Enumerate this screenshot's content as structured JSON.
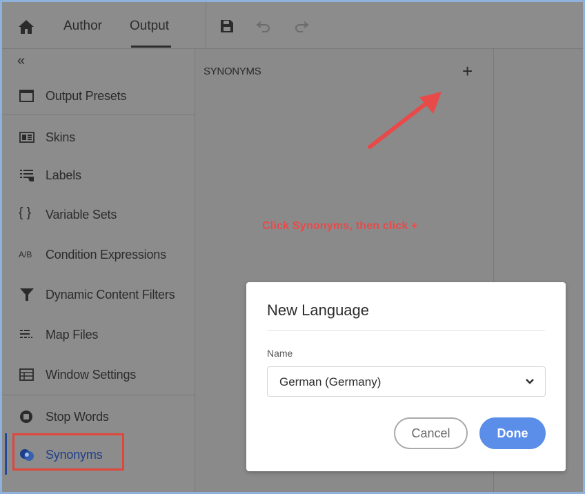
{
  "header": {
    "tabs": [
      {
        "label": "Author"
      },
      {
        "label": "Output",
        "active": true
      }
    ],
    "icons": [
      "home-icon",
      "save-icon",
      "undo-icon",
      "redo-icon"
    ]
  },
  "sidebar": {
    "collapse_glyph": "«",
    "items": [
      {
        "label": "Output Presets",
        "icon": "output-presets-icon"
      },
      {
        "label": "Skins",
        "icon": "skins-icon"
      },
      {
        "label": "Labels",
        "icon": "labels-icon"
      },
      {
        "label": "Variable Sets",
        "icon": "braces-icon"
      },
      {
        "label": "Condition Expressions",
        "icon": "ab-icon"
      },
      {
        "label": "Dynamic Content Filters",
        "icon": "filter-icon"
      },
      {
        "label": "Map Files",
        "icon": "map-files-icon"
      },
      {
        "label": "Window Settings",
        "icon": "window-settings-icon"
      },
      {
        "label": "Stop Words",
        "icon": "stop-words-icon"
      },
      {
        "label": "Synonyms",
        "icon": "synonyms-icon",
        "active": true
      }
    ]
  },
  "panel": {
    "title": "SYNONYMS",
    "add_glyph": "+",
    "annotation": "Click Synonyms, then click +"
  },
  "dialog": {
    "title": "New Language",
    "field_label": "Name",
    "selected_value": "German (Germany)",
    "cancel_label": "Cancel",
    "done_label": "Done"
  },
  "colors": {
    "annotation_red": "#e84a4a",
    "highlight_red": "#e2463b",
    "primary_blue": "#5a8ee8",
    "dim_overlay": "#8a8a8a"
  }
}
